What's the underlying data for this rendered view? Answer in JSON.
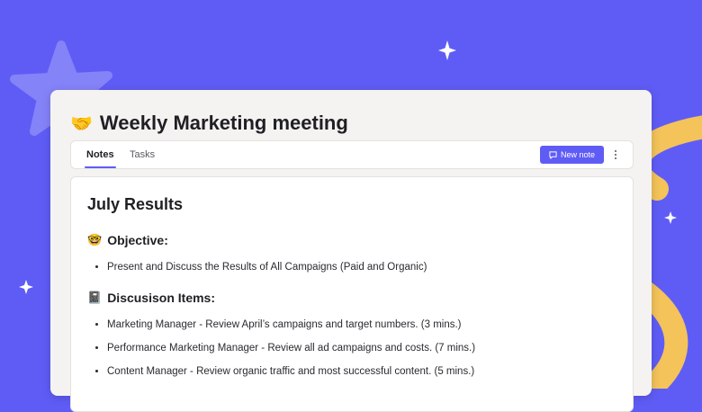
{
  "page": {
    "title": "Weekly Marketing meeting",
    "title_icon": "handshake-icon",
    "title_emoji": "🤝"
  },
  "tabs": [
    {
      "label": "Notes",
      "active": true
    },
    {
      "label": "Tasks",
      "active": false
    }
  ],
  "toolbar": {
    "new_note_label": "New note",
    "new_note_icon": "comment-icon",
    "more_icon": "more-vertical-icon"
  },
  "note": {
    "heading": "July Results",
    "sections": [
      {
        "emoji": "🤓",
        "icon": "nerd-face-icon",
        "title": "Objective:",
        "items": [
          "Present and Discuss the Results of All Campaigns (Paid and Organic)"
        ]
      },
      {
        "emoji": "📓",
        "icon": "notebook-icon",
        "title": "Discusison Items:",
        "items": [
          "Marketing Manager - Review April’s campaigns and target numbers. (3 mins.)",
          "Performance Marketing Manager - Review all ad campaigns and costs. (7 mins.)",
          "Content Manager - Review organic traffic and most successful content. (5 mins.)"
        ]
      }
    ]
  },
  "colors": {
    "background": "#5f5cf6",
    "accent": "#5f5cf6",
    "ribbon": "#f4c35a",
    "star_shape": "#8583f8"
  }
}
